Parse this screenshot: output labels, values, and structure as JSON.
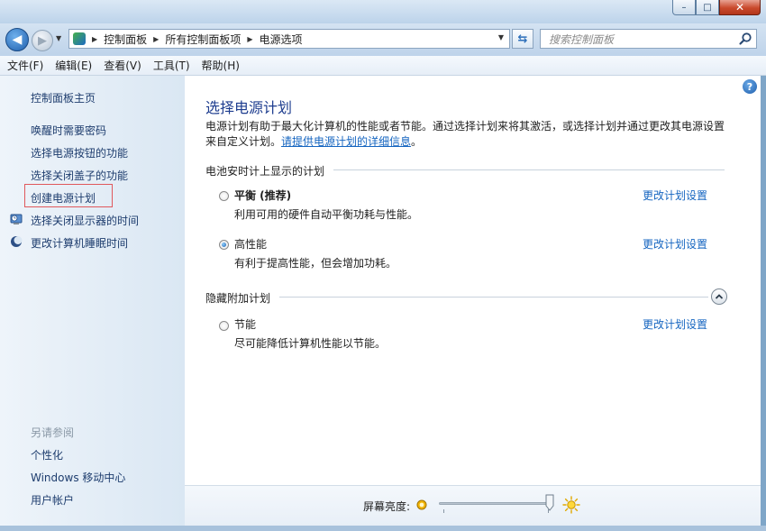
{
  "window": {
    "minimize_label": "–",
    "maximize_label": "□",
    "close_label": "✕"
  },
  "address": {
    "crumbs": [
      "控制面板",
      "所有控制面板项",
      "电源选项"
    ]
  },
  "search": {
    "placeholder": "搜索控制面板"
  },
  "menu": {
    "items": [
      "文件(F)",
      "编辑(E)",
      "查看(V)",
      "工具(T)",
      "帮助(H)"
    ]
  },
  "sidebar": {
    "home": "控制面板主页",
    "tasks": [
      "唤醒时需要密码",
      "选择电源按钮的功能",
      "选择关闭盖子的功能",
      "创建电源计划",
      "选择关闭显示器的时间",
      "更改计算机睡眠时间"
    ],
    "see_also_title": "另请参阅",
    "see_also": [
      "个性化",
      "Windows 移动中心",
      "用户帐户"
    ]
  },
  "content": {
    "help_label": "?",
    "title": "选择电源计划",
    "intro_line1": "电源计划有助于最大化计算机的性能或者节能。通过选择计划来将其激活，或选择计划并通过更改其电源设置",
    "intro_line2_prefix": "来自定义计划。",
    "intro_link": "请提供电源计划的详细信息",
    "intro_suffix": "。",
    "battery_group_title": "电池安时计上显示的计划",
    "hidden_group_title": "隐藏附加计划",
    "plans": [
      {
        "name": "平衡 (推荐)",
        "desc": "利用可用的硬件自动平衡功耗与性能。",
        "selected": false
      },
      {
        "name": "高性能",
        "desc": "有利于提高性能，但会增加功耗。",
        "selected": true
      }
    ],
    "hidden_plans": [
      {
        "name": "节能",
        "desc": "尽可能降低计算机性能以节能。",
        "selected": false
      }
    ],
    "change_link": "更改计划设置"
  },
  "brightness": {
    "label": "屏幕亮度:",
    "value_fraction": 0.98
  }
}
